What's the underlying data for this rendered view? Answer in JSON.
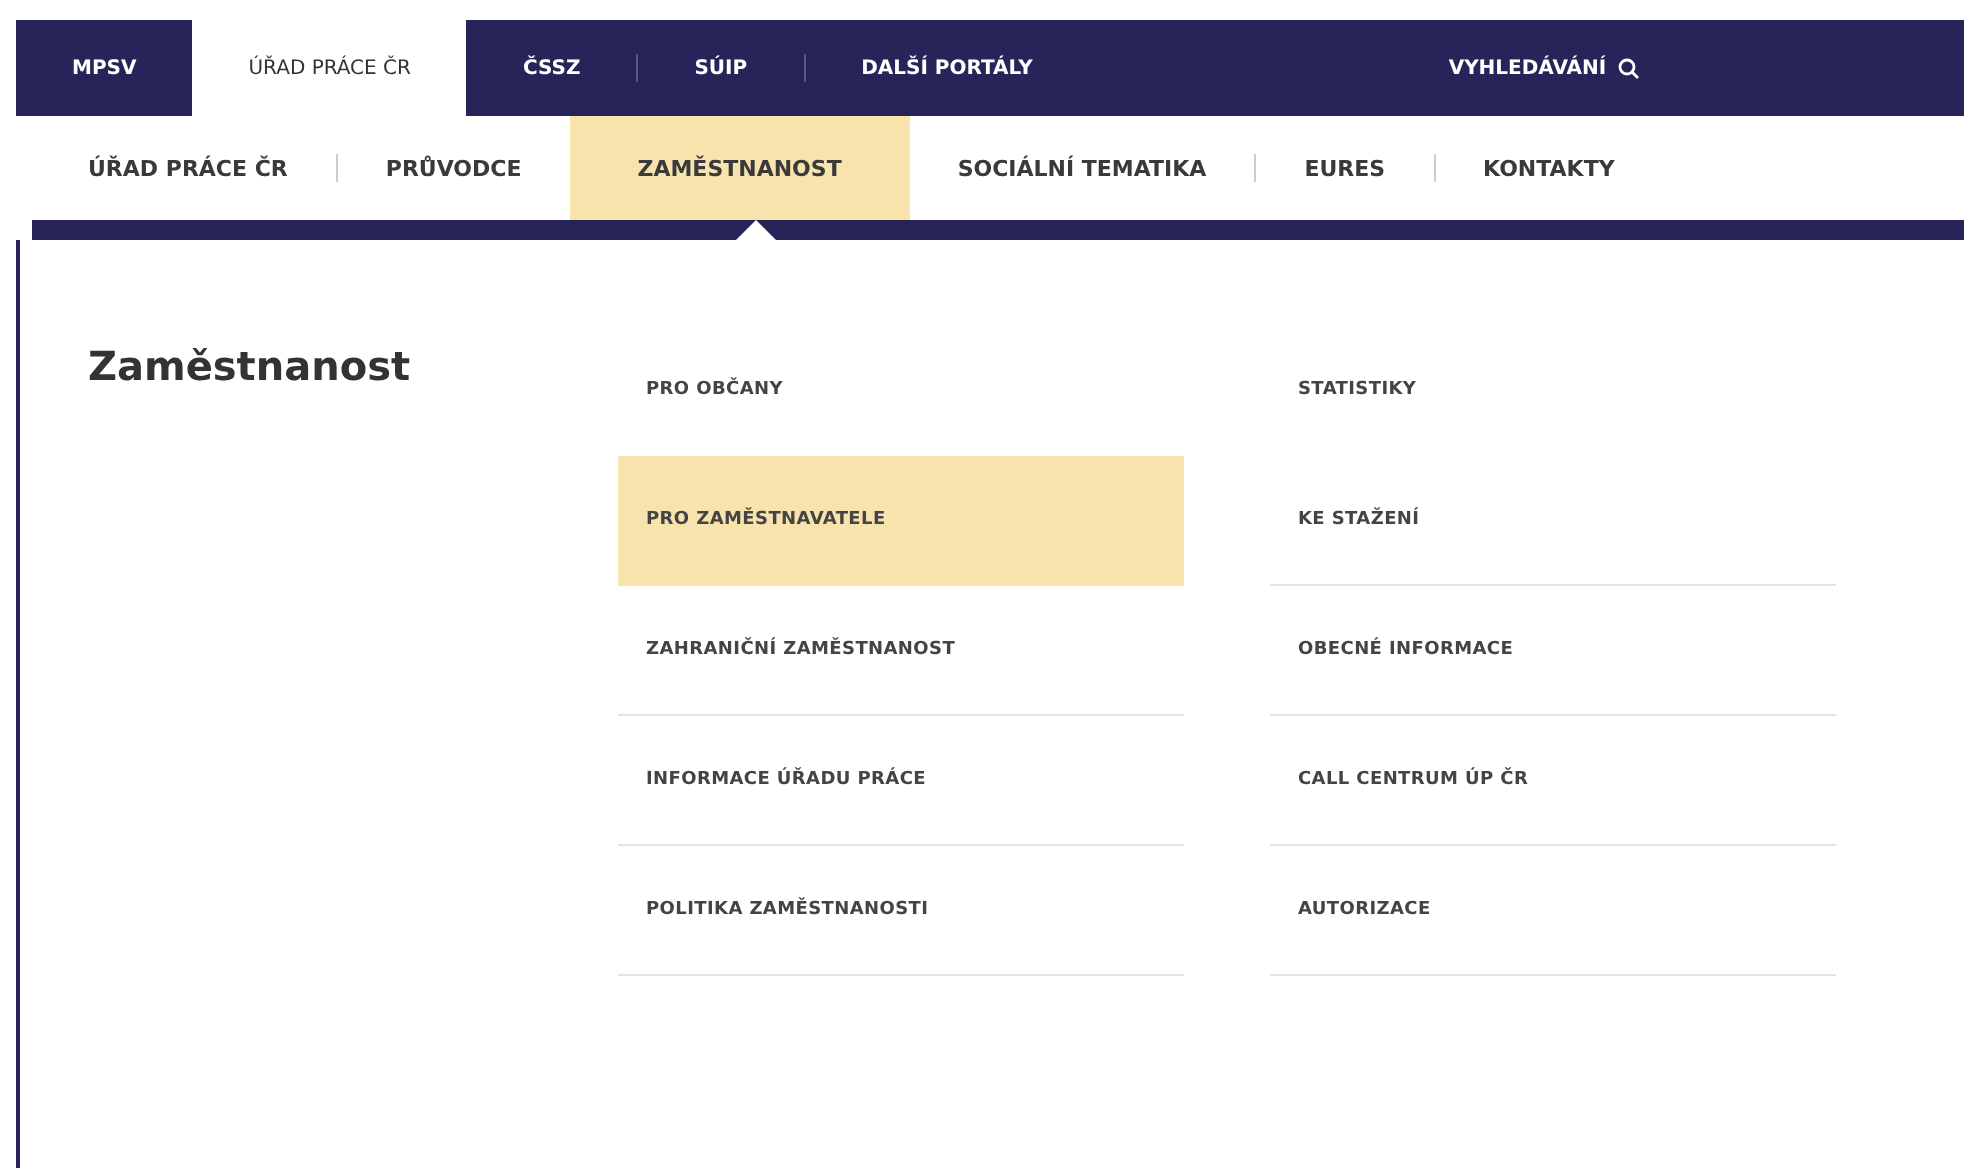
{
  "portal_bar": {
    "tabs": [
      {
        "label": "MPSV",
        "selected": false
      },
      {
        "label": "ÚŘAD PRÁCE ČR",
        "selected": true
      },
      {
        "label": "ČSSZ",
        "selected": false
      },
      {
        "label": "SÚIP",
        "selected": false
      },
      {
        "label": "DALŠÍ PORTÁLY",
        "selected": false
      }
    ],
    "search": {
      "label": "VYHLEDÁVÁNÍ"
    }
  },
  "main_nav": {
    "items": [
      {
        "label": "ÚŘAD PRÁCE ČR",
        "selected": false
      },
      {
        "label": "PRŮVODCE",
        "selected": false
      },
      {
        "label": "ZAMĚSTNANOST",
        "selected": true
      },
      {
        "label": "SOCIÁLNÍ TEMATIKA",
        "selected": false
      },
      {
        "label": "EURES",
        "selected": false
      },
      {
        "label": "KONTAKTY",
        "selected": false
      }
    ]
  },
  "mega_menu": {
    "title": "Zaměstnanost",
    "columns": [
      [
        {
          "label": "PRO OBČANY",
          "selected": false
        },
        {
          "label": "PRO ZAMĚSTNAVATELE",
          "selected": true
        },
        {
          "label": "ZAHRANIČNÍ ZAMĚSTNANOST",
          "selected": false
        },
        {
          "label": "INFORMACE ÚŘADU PRÁCE",
          "selected": false
        },
        {
          "label": "POLITIKA ZAMĚSTNANOSTI",
          "selected": false
        }
      ],
      [
        {
          "label": "STATISTIKY",
          "selected": false
        },
        {
          "label": "KE STAŽENÍ",
          "selected": false
        },
        {
          "label": "OBECNÉ INFORMACE",
          "selected": false
        },
        {
          "label": "CALL CENTRUM ÚP ČR",
          "selected": false
        },
        {
          "label": "AUTORIZACE",
          "selected": false
        }
      ]
    ]
  }
}
